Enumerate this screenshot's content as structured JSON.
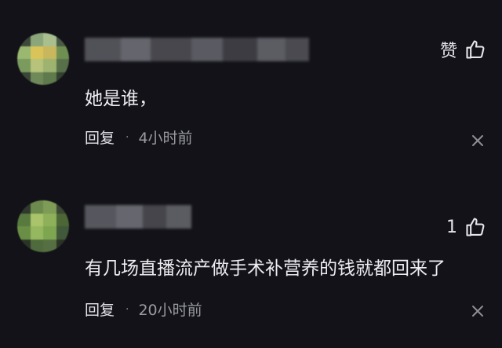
{
  "comments": [
    {
      "like_label": "赞",
      "text": "她是谁，",
      "reply_label": "回复",
      "separator": "·",
      "time": "4小时前"
    },
    {
      "like_label": "1",
      "text": "有几场直播流产做手术补营养的钱就都回来了",
      "reply_label": "回复",
      "separator": "·",
      "time": "20小时前"
    }
  ],
  "colors": {
    "background": "#121218",
    "text": "#ececf1",
    "muted": "#9a9aa2"
  },
  "icons": [
    "thumbs-up-icon",
    "close-icon"
  ]
}
